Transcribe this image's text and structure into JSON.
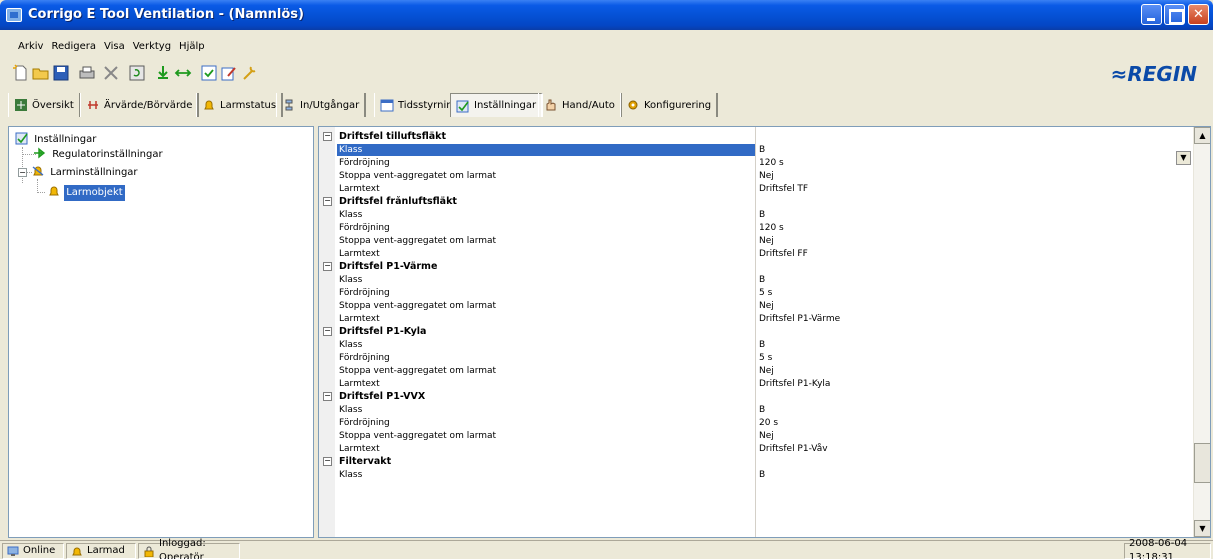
{
  "window": {
    "title": "Corrigo E Tool Ventilation - (Namnlös)"
  },
  "menu": [
    {
      "label": "Arkiv"
    },
    {
      "label": "Redigera"
    },
    {
      "label": "Visa"
    },
    {
      "label": "Verktyg"
    },
    {
      "label": "Hjälp"
    }
  ],
  "brand": {
    "logo_text": "≈REGIN",
    "color": "#0b4aa8"
  },
  "tabs": [
    {
      "label": "Översikt",
      "icon": "overview-icon"
    },
    {
      "label": "Ärvärde/Börvärde",
      "icon": "setpoint-icon"
    },
    {
      "label": "Larmstatus",
      "icon": "alarm-bell-icon"
    },
    {
      "label": "In/Utgångar",
      "icon": "io-icon"
    },
    {
      "label": "Tidsstyrning",
      "icon": "calendar-icon"
    },
    {
      "label": "Inställningar",
      "icon": "settings-check-icon",
      "active": true
    },
    {
      "label": "Hand/Auto",
      "icon": "hand-icon"
    },
    {
      "label": "Konfigurering",
      "icon": "config-icon"
    }
  ],
  "tree": [
    {
      "label": "Inställningar",
      "icon": "settings-check-icon"
    },
    {
      "label": "Regulatorinställningar",
      "icon": "arrow-right-icon"
    },
    {
      "label": "Larminställningar",
      "icon": "alarm-bell-icon"
    },
    {
      "label": "Larmobjekt",
      "icon": "alarm-bell-icon",
      "selected": true
    }
  ],
  "grid": [
    {
      "category": "Driftsfel tilluftsfläkt",
      "rows": [
        {
          "name": "Klass",
          "value": "B"
        },
        {
          "name": "Fördröjning",
          "value": "120 s"
        },
        {
          "name": "Stoppa vent-aggregatet om larmat",
          "value": "Nej"
        },
        {
          "name": "Larmtext",
          "value": "Driftsfel TF"
        }
      ]
    },
    {
      "category": "Driftsfel frånluftsfläkt",
      "rows": [
        {
          "name": "Klass",
          "value": "B"
        },
        {
          "name": "Fördröjning",
          "value": "120 s"
        },
        {
          "name": "Stoppa vent-aggregatet om larmat",
          "value": "Nej"
        },
        {
          "name": "Larmtext",
          "value": "Driftsfel FF"
        }
      ]
    },
    {
      "category": "Driftsfel P1-Värme",
      "rows": [
        {
          "name": "Klass",
          "value": "B"
        },
        {
          "name": "Fördröjning",
          "value": "5 s"
        },
        {
          "name": "Stoppa vent-aggregatet om larmat",
          "value": "Nej"
        },
        {
          "name": "Larmtext",
          "value": "Driftsfel P1-Värme"
        }
      ]
    },
    {
      "category": "Driftsfel P1-Kyla",
      "rows": [
        {
          "name": "Klass",
          "value": "B"
        },
        {
          "name": "Fördröjning",
          "value": "5 s"
        },
        {
          "name": "Stoppa vent-aggregatet om larmat",
          "value": "Nej"
        },
        {
          "name": "Larmtext",
          "value": "Driftsfel P1-Kyla"
        }
      ]
    },
    {
      "category": "Driftsfel P1-VVX",
      "rows": [
        {
          "name": "Klass",
          "value": "B"
        },
        {
          "name": "Fördröjning",
          "value": "20 s"
        },
        {
          "name": "Stoppa vent-aggregatet om larmat",
          "value": "Nej"
        },
        {
          "name": "Larmtext",
          "value": "Driftsfel P1-Våv"
        }
      ]
    },
    {
      "category": "Filtervakt",
      "rows": [
        {
          "name": "Klass",
          "value": "B"
        }
      ]
    }
  ],
  "status": {
    "connection": "Online",
    "alarm": "Larmad",
    "login": "Inloggad: Operatör",
    "timestamp": "2008-06-04 13:18:31"
  },
  "colors": {
    "selection": "#316ac5",
    "titlebar": "#0552d6",
    "background": "#ece9d8"
  }
}
